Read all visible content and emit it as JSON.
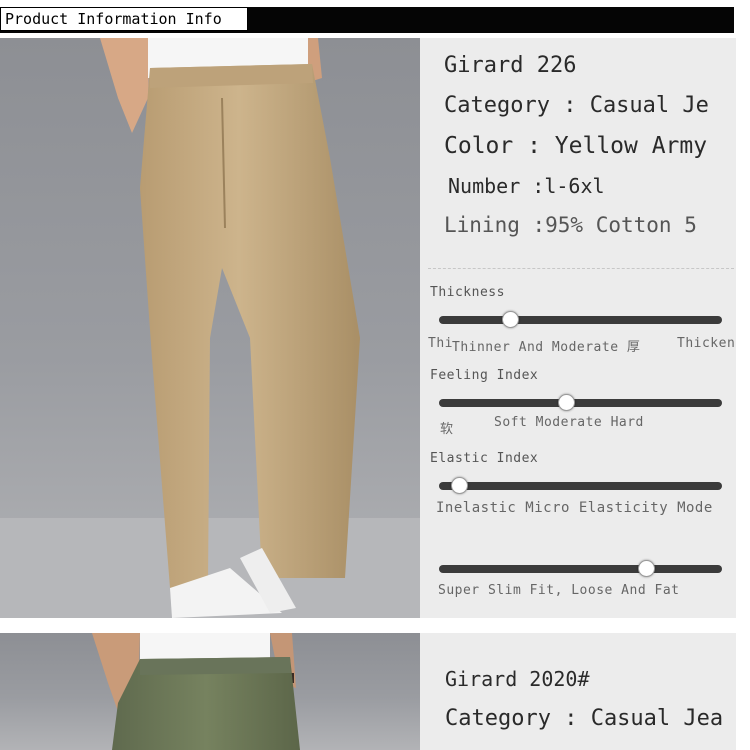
{
  "header": {
    "title": "Product Information Info"
  },
  "photos": [
    {
      "name": "pants-khaki"
    },
    {
      "name": "pants-army-green"
    }
  ],
  "product1": {
    "lines": [
      "Girard 226",
      "Category : Casual Je",
      "Color : Yellow Army",
      "Number :l-6xl",
      "Lining :95% Cotton 5"
    ],
    "sliders": [
      {
        "label": "Thickness",
        "level": 0.25,
        "scale_left": "Thi",
        "scale_mid": "Thinner And Moderate 厚",
        "scale_right": "Thicken"
      },
      {
        "label": "Feeling Index",
        "level": 0.45,
        "scale_left": "软",
        "scale_mid": "Soft Moderate Hard"
      },
      {
        "label": "Elastic Index",
        "level": 0.07,
        "scale_mid": "Inelastic Micro Elasticity Mode"
      },
      {
        "level": 0.73,
        "scale_mid": "Super Slim Fit, Loose And Fat"
      }
    ]
  },
  "product2": {
    "lines": [
      "Girard 2020#",
      "Category : Casual Jea"
    ]
  },
  "colors": {
    "header_bar": "#050505",
    "panel": "#ececec",
    "track": "#3b3b3b",
    "khaki": "#c7ad84",
    "army_green": "#6e7a5c"
  }
}
